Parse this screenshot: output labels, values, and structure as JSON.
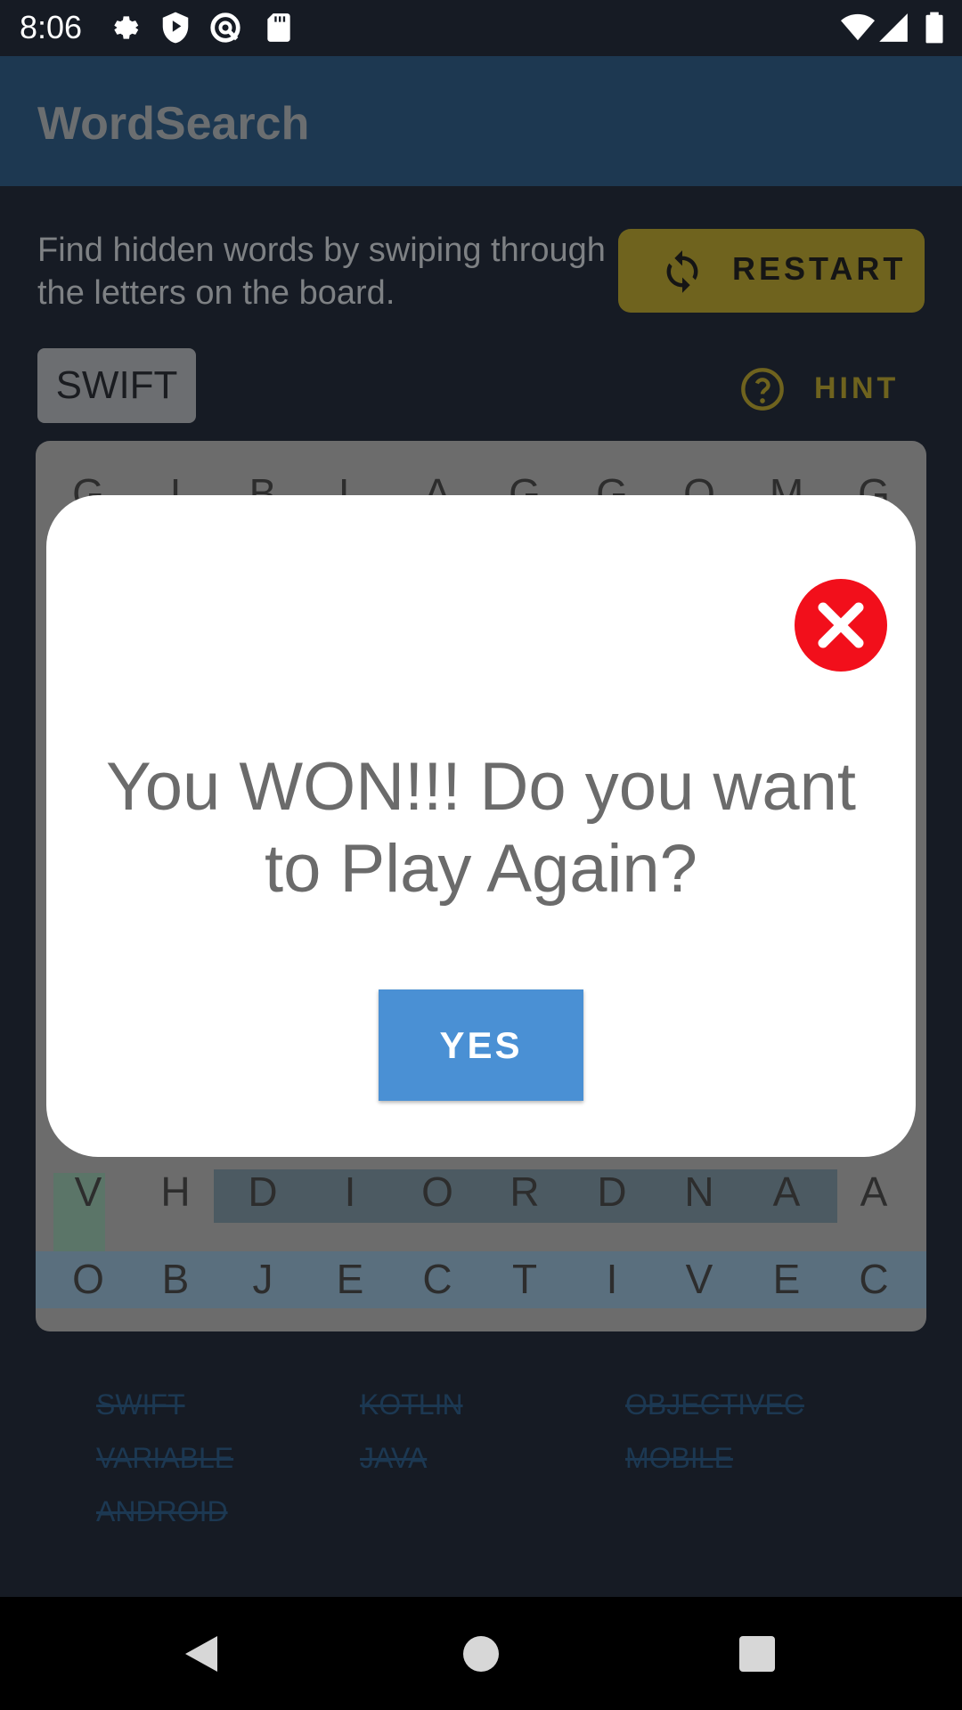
{
  "status_bar": {
    "time": "8:06",
    "icons": [
      "settings-icon",
      "shield-play-icon",
      "at-sign-icon",
      "sd-card-icon",
      "wifi-icon",
      "signal-icon",
      "battery-icon"
    ]
  },
  "app_bar": {
    "title": "WordSearch"
  },
  "main": {
    "instructions": "Find hidden words by swiping through the letters on the board.",
    "restart_label": "RESTART",
    "current_word": "SWIFT",
    "hint_label": "HINT"
  },
  "board": {
    "rows": [
      [
        "G",
        "I",
        "B",
        "L",
        "A",
        "G",
        "G",
        "O",
        "M",
        "G"
      ],
      [
        "",
        "",
        "",
        "",
        "",
        "",
        "",
        "",
        "",
        ""
      ],
      [
        "",
        "",
        "",
        "",
        "",
        "",
        "",
        "",
        "",
        ""
      ],
      [
        "",
        "",
        "",
        "",
        "",
        "",
        "",
        "",
        "",
        ""
      ],
      [
        "",
        "",
        "",
        "",
        "",
        "",
        "",
        "",
        "",
        ""
      ],
      [
        "",
        "",
        "",
        "",
        "",
        "",
        "",
        "",
        "",
        ""
      ],
      [
        "",
        "",
        "",
        "",
        "",
        "",
        "",
        "",
        "",
        ""
      ],
      [
        "",
        "",
        "",
        "",
        "",
        "",
        "",
        "",
        "",
        ""
      ],
      [
        "V",
        "H",
        "D",
        "I",
        "O",
        "R",
        "D",
        "N",
        "A",
        "A"
      ],
      [
        "O",
        "B",
        "J",
        "E",
        "C",
        "T",
        "I",
        "V",
        "E",
        "C"
      ]
    ]
  },
  "word_list": {
    "words": [
      "SWIFT",
      "KOTLIN",
      "OBJECTIVEC",
      "VARIABLE",
      "JAVA",
      "MOBILE",
      "ANDROID"
    ]
  },
  "dialog": {
    "message": "You WON!!! Do you want to Play Again?",
    "yes_label": "YES"
  },
  "colors": {
    "app_bar": "#1d3851",
    "restart_button": "#6f631e",
    "close_button": "#f20f1b",
    "yes_button": "#4a90d4"
  }
}
